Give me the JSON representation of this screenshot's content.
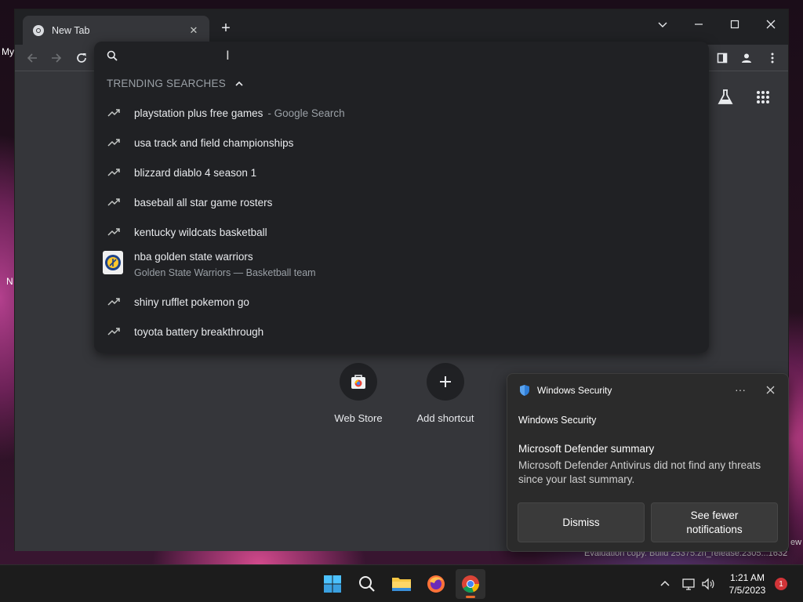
{
  "desktop": {
    "left_labels": [
      "My",
      "N"
    ],
    "watermark": "Evaluation copy. Build 25375.zn_release.2305...1632",
    "watermark_tail": "ew"
  },
  "browser": {
    "tab": {
      "title": "New Tab",
      "favicon": "chrome-icon"
    },
    "omnibox": {
      "query": "",
      "section_header": "TRENDING SEARCHES",
      "suggestions": [
        {
          "text": "playstation plus free games",
          "suffix": "- Google Search",
          "icon": "trending-icon"
        },
        {
          "text": "usa track and field championships",
          "icon": "trending-icon"
        },
        {
          "text": "blizzard diablo 4 season 1",
          "icon": "trending-icon"
        },
        {
          "text": "baseball all star game rosters",
          "icon": "trending-icon"
        },
        {
          "text": "kentucky wildcats basketball",
          "icon": "trending-icon"
        },
        {
          "text": "nba golden state warriors",
          "subtitle": "Golden State Warriors — Basketball team",
          "icon": "warriors-logo"
        },
        {
          "text": "shiny rufflet pokemon go",
          "icon": "trending-icon"
        },
        {
          "text": "toyota battery breakthrough",
          "icon": "trending-icon"
        }
      ]
    },
    "shortcuts": [
      {
        "label": "Web Store",
        "icon": "web-store-icon"
      },
      {
        "label": "Add shortcut",
        "icon": "plus-icon"
      }
    ]
  },
  "notification": {
    "app_name": "Windows Security",
    "source": "Windows Security",
    "title": "Microsoft Defender summary",
    "body": "Microsoft Defender Antivirus did not find any threats since your last summary.",
    "buttons": {
      "dismiss": "Dismiss",
      "fewer": "See fewer notifications"
    }
  },
  "taskbar": {
    "apps": [
      "start-icon",
      "search-icon",
      "file-explorer-icon",
      "firefox-icon",
      "chrome-icon"
    ],
    "time": "1:21 AM",
    "date": "7/5/2023",
    "notification_count": "1"
  },
  "colors": {
    "accent_indicator": "#ea6b2c",
    "badge": "#d13438",
    "chrome_dark": "#202124",
    "chrome_surface": "#35363a"
  }
}
